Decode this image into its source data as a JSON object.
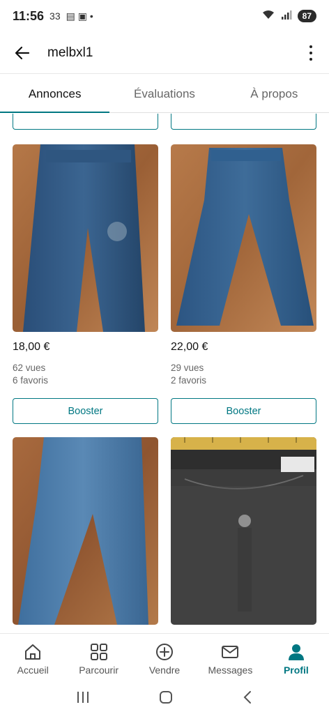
{
  "status_bar": {
    "time": "11:56",
    "extra": "33",
    "battery": "87"
  },
  "header": {
    "username": "melbxl1"
  },
  "tabs": [
    {
      "label": "Annonces",
      "active": true
    },
    {
      "label": "Évaluations",
      "active": false
    },
    {
      "label": "À propos",
      "active": false
    }
  ],
  "listings": [
    {
      "price": "18,00 €",
      "views": "62 vues",
      "favorites": "6 favoris",
      "button": "Booster"
    },
    {
      "price": "22,00 €",
      "views": "29 vues",
      "favorites": "2 favoris",
      "button": "Booster"
    }
  ],
  "bottom_nav": [
    {
      "label": "Accueil",
      "icon": "home-icon"
    },
    {
      "label": "Parcourir",
      "icon": "grid-icon"
    },
    {
      "label": "Vendre",
      "icon": "plus-circle-icon"
    },
    {
      "label": "Messages",
      "icon": "mail-icon"
    },
    {
      "label": "Profil",
      "icon": "profile-icon",
      "active": true
    }
  ],
  "colors": {
    "accent": "#007782"
  }
}
